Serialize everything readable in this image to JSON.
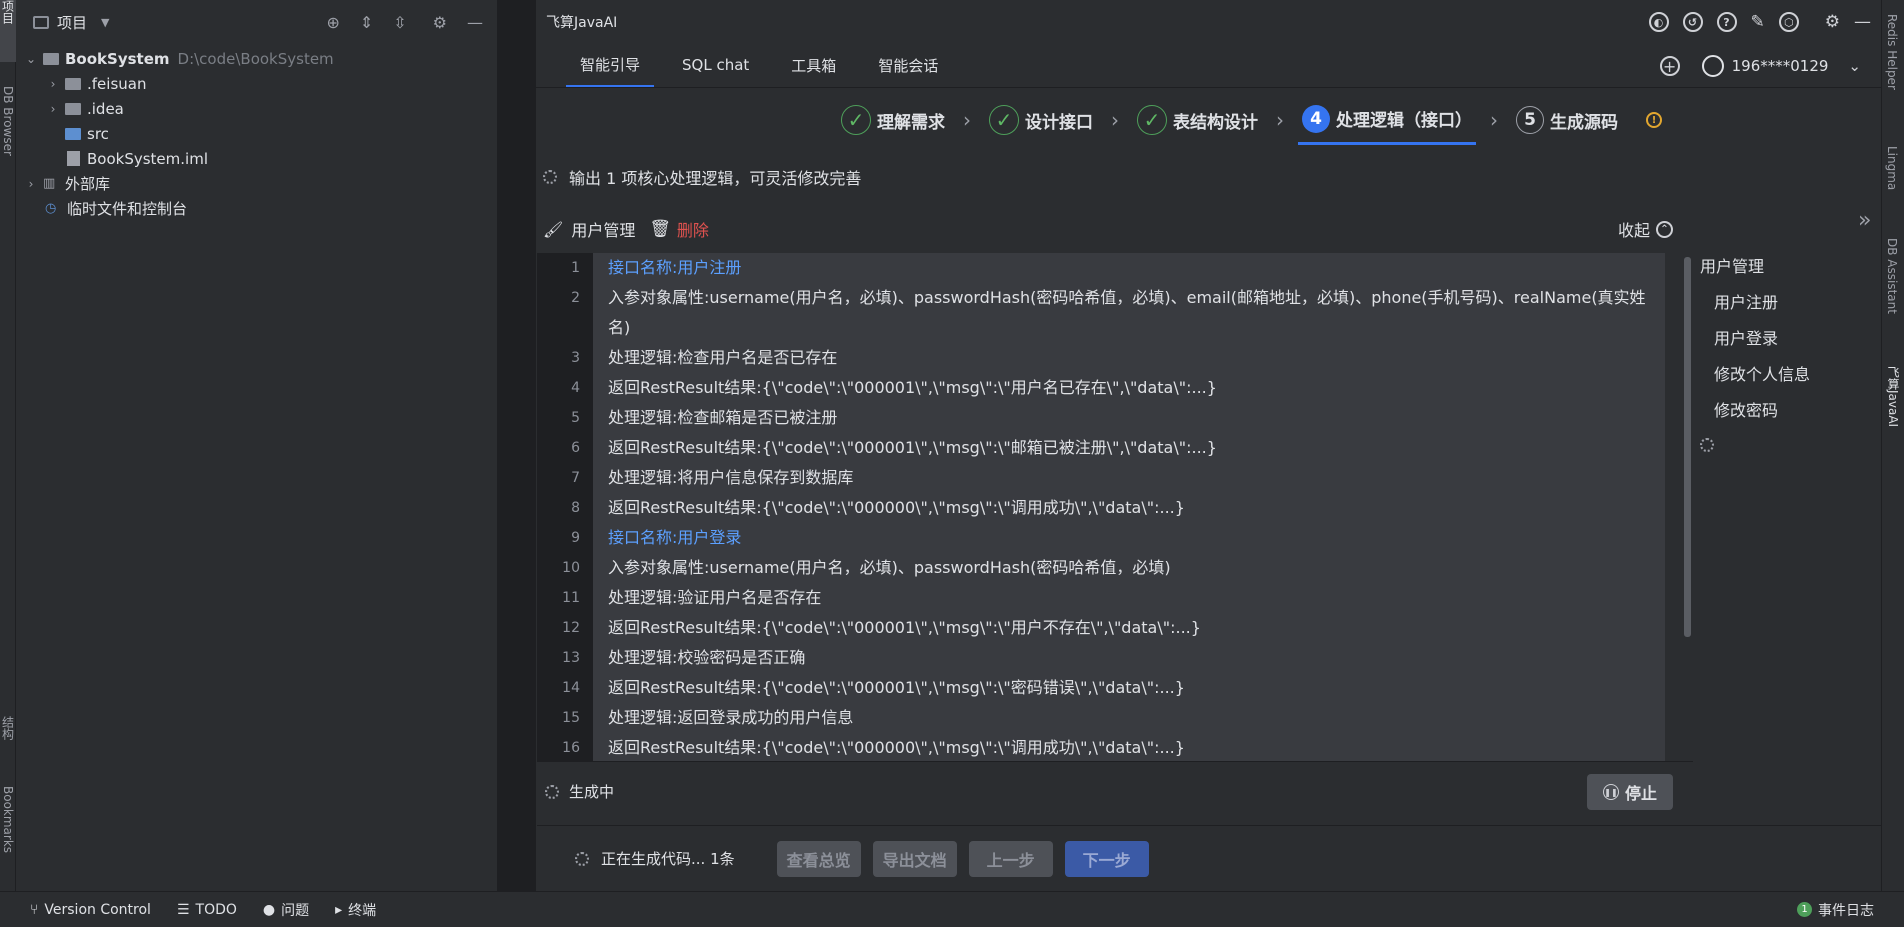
{
  "left_strip": {
    "project_tab": "项目",
    "db_browser_tab": "DB Browser",
    "structure_tab": "结构",
    "bookmarks_tab": "Bookmarks"
  },
  "project_panel": {
    "title": "项目",
    "tree": [
      {
        "label": "BookSystem",
        "path": "D:\\code\\BookSystem"
      },
      {
        "label": ".feisuan"
      },
      {
        "label": ".idea"
      },
      {
        "label": "src"
      },
      {
        "label": "BookSystem.iml"
      },
      {
        "label": "外部库"
      },
      {
        "label": "临时文件和控制台"
      }
    ]
  },
  "plugin": {
    "title": "飞算JavaAI",
    "tabs": [
      "智能引导",
      "SQL chat",
      "工具箱",
      "智能会话"
    ],
    "user": "196****0129",
    "steps": [
      {
        "label": "理解需求",
        "state": "done"
      },
      {
        "label": "设计接口",
        "state": "done"
      },
      {
        "label": "表结构设计",
        "state": "done"
      },
      {
        "num": "4",
        "label": "处理逻辑（接口）",
        "state": "active"
      },
      {
        "num": "5",
        "label": "生成源码",
        "state": "todo"
      }
    ],
    "status_text": "输出 1 项核心处理逻辑，可灵活修改完善",
    "group_name": "用户管理",
    "delete_label": "删除",
    "collapse_label": "收起",
    "code_lines": [
      {
        "n": "1",
        "text": "接口名称:用户注册",
        "hl": true
      },
      {
        "n": "2",
        "text": "入参对象属性:username(用户名，必填)、passwordHash(密码哈希值，必填)、email(邮箱地址，必填)、phone(手机号码)、realName(真实姓名)",
        "wrap": true
      },
      {
        "n": "3",
        "text": "处理逻辑:检查用户名是否已存在"
      },
      {
        "n": "4",
        "text": "返回RestResult结果:{\\\"code\\\":\\\"000001\\\",\\\"msg\\\":\\\"用户名已存在\\\",\\\"data\\\":...}"
      },
      {
        "n": "5",
        "text": "处理逻辑:检查邮箱是否已被注册"
      },
      {
        "n": "6",
        "text": "返回RestResult结果:{\\\"code\\\":\\\"000001\\\",\\\"msg\\\":\\\"邮箱已被注册\\\",\\\"data\\\":...}"
      },
      {
        "n": "7",
        "text": "处理逻辑:将用户信息保存到数据库"
      },
      {
        "n": "8",
        "text": "返回RestResult结果:{\\\"code\\\":\\\"000000\\\",\\\"msg\\\":\\\"调用成功\\\",\\\"data\\\":...}"
      },
      {
        "n": "9",
        "text": "接口名称:用户登录",
        "hl": true
      },
      {
        "n": "10",
        "text": "入参对象属性:username(用户名，必填)、passwordHash(密码哈希值，必填)"
      },
      {
        "n": "11",
        "text": "处理逻辑:验证用户名是否存在"
      },
      {
        "n": "12",
        "text": "返回RestResult结果:{\\\"code\\\":\\\"000001\\\",\\\"msg\\\":\\\"用户不存在\\\",\\\"data\\\":...}"
      },
      {
        "n": "13",
        "text": "处理逻辑:校验密码是否正确"
      },
      {
        "n": "14",
        "text": "返回RestResult结果:{\\\"code\\\":\\\"000001\\\",\\\"msg\\\":\\\"密码错误\\\",\\\"data\\\":...}"
      },
      {
        "n": "15",
        "text": "处理逻辑:返回登录成功的用户信息"
      },
      {
        "n": "16",
        "text": "返回RestResult结果:{\\\"code\\\":\\\"000000\\\",\\\"msg\\\":\\\"调用成功\\\",\\\"data\\\":...}"
      }
    ],
    "outline": {
      "group": "用户管理",
      "items": [
        "用户注册",
        "用户登录",
        "修改个人信息",
        "修改密码"
      ]
    },
    "generating_label": "生成中",
    "stop_label": "停止",
    "footer": {
      "progress": "正在生成代码... 1条",
      "overview": "查看总览",
      "export": "导出文档",
      "prev": "上一步",
      "next": "下一步"
    }
  },
  "right_strip": {
    "redis": "Redis Helper",
    "lingma": "Lingma",
    "db_assistant": "DB Assistant",
    "javaai": "飞算JavaAI"
  },
  "statusbar": {
    "version_control": "Version Control",
    "todo": "TODO",
    "problems": "问题",
    "terminal": "终端",
    "event_log": "事件日志",
    "event_count": "1"
  }
}
